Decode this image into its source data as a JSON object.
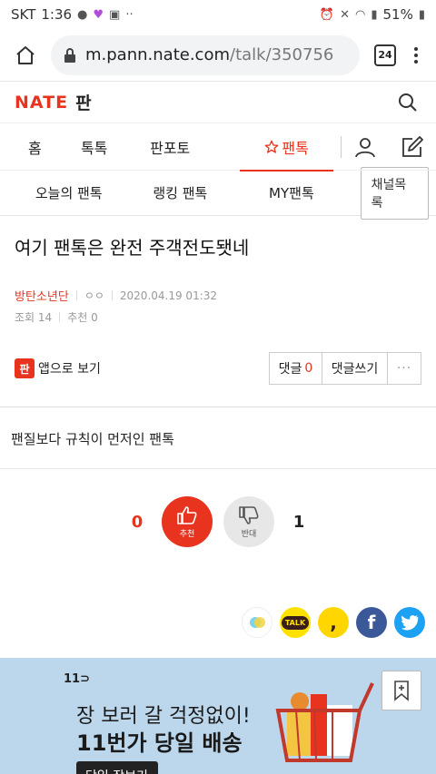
{
  "status_bar": {
    "carrier": "SKT",
    "time": "1:36",
    "battery": "51%"
  },
  "browser": {
    "url_host": "m.pann.nate.com",
    "url_path": "/talk/350756",
    "tab_count": "24"
  },
  "header": {
    "logo": "NATE",
    "section": "판"
  },
  "main_nav": {
    "items": [
      "홈",
      "톡톡",
      "판포토",
      "팬톡"
    ],
    "active": "팬톡"
  },
  "sub_nav": {
    "items": [
      "오늘의 팬톡",
      "랭킹 팬톡",
      "MY팬톡"
    ],
    "channel_button": "채널목록"
  },
  "article": {
    "title": "여기 팬톡은 완전 주객전도됏네",
    "author": "방탄소년단",
    "nickname": "ㅇㅇ",
    "datetime": "2020.04.19 01:32",
    "views_label": "조회",
    "views": "14",
    "recommend_label": "추천",
    "recommend": "0",
    "app_button": "앱으로 보기",
    "app_icon_text": "판",
    "comment_label": "댓글",
    "comment_count": "0",
    "write_comment": "댓글쓰기",
    "more": "···",
    "body": "팬질보다 규칙이 먼저인 팬톡"
  },
  "vote": {
    "up_count": "0",
    "up_label": "추천",
    "down_label": "반대",
    "down_count": "1"
  },
  "share": {
    "talk_label": "TALK"
  },
  "ad": {
    "brand": "11",
    "line1": "장 보러 갈 걱정없이!",
    "line2": "11번가 당일 배송",
    "button": "당일 장보기"
  },
  "colors": {
    "accent": "#e8331e",
    "ad_bg": "#bcd6ec"
  }
}
